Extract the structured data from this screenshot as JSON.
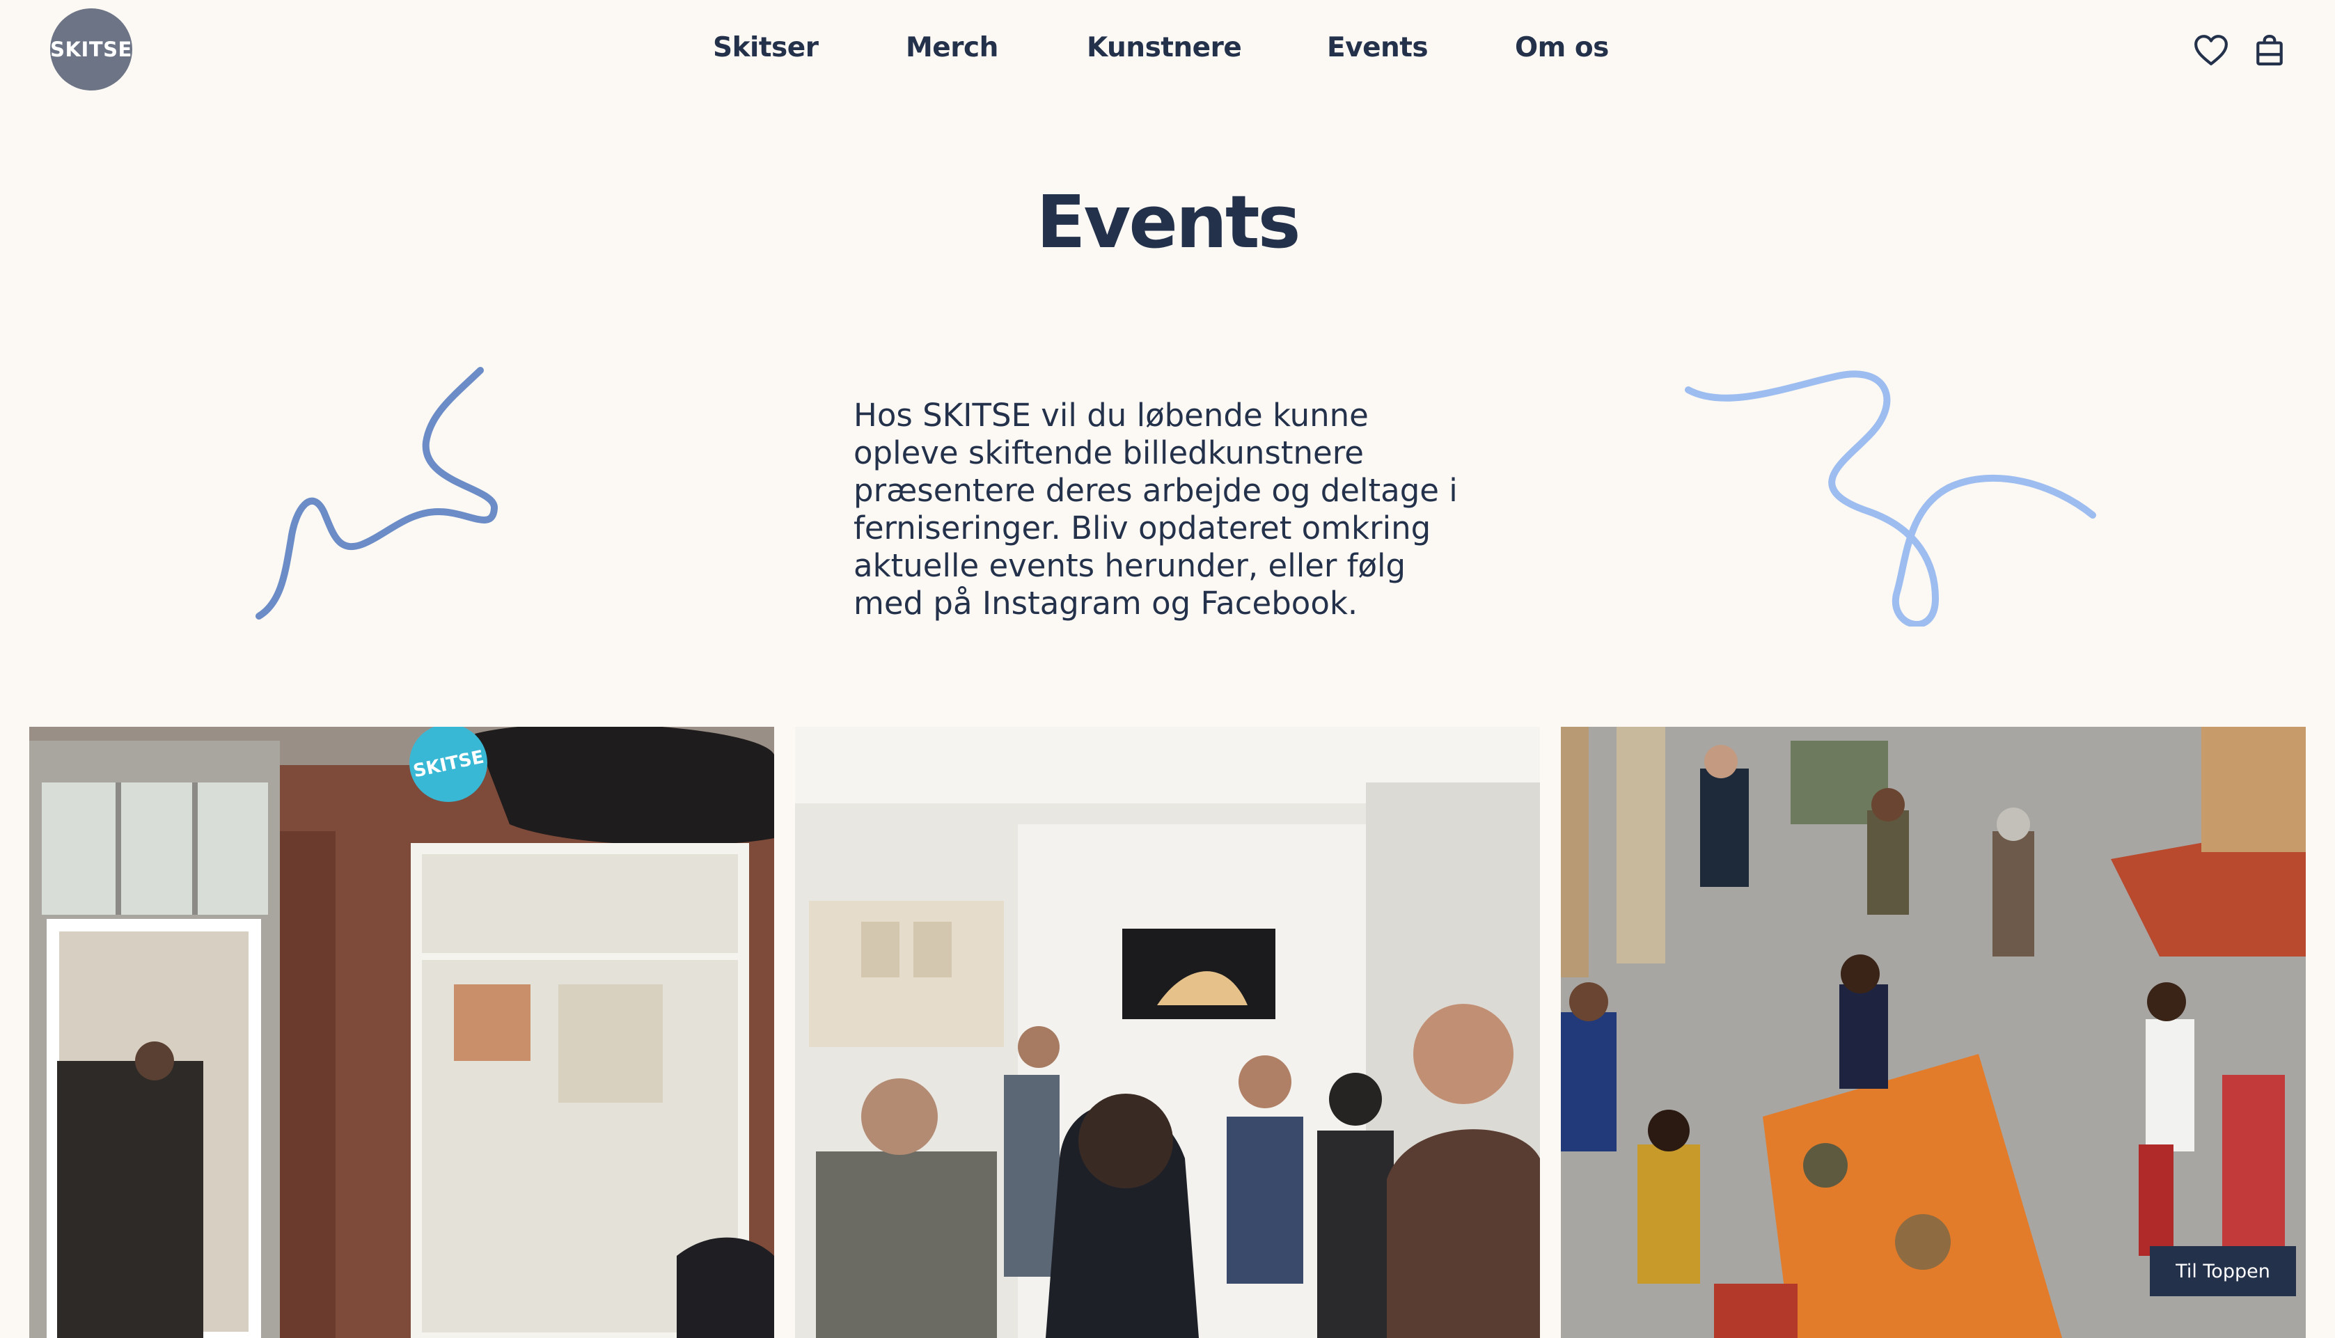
{
  "brand": {
    "logo_text": "SKITSE"
  },
  "nav": {
    "items": [
      {
        "label": "Skitser"
      },
      {
        "label": "Merch"
      },
      {
        "label": "Kunstnere"
      },
      {
        "label": "Events"
      },
      {
        "label": "Om os"
      }
    ]
  },
  "header_icons": [
    "heart-icon",
    "shopping-bag-icon"
  ],
  "page": {
    "title": "Events",
    "intro": "Hos SKITSE vil du løbende kunne opleve skiftende billedkunstnere præsentere deres arbejde og deltage i ferniseringer. Bliv opdateret omkring aktuelle events herunder, eller følg med på Instagram og Facebook."
  },
  "gallery": {
    "photos": [
      {
        "sign_text": "SKITSE"
      },
      {},
      {}
    ]
  },
  "to_top": {
    "label": "Til Toppen"
  },
  "colors": {
    "background": "#fcf9f4",
    "text": "#24314b",
    "logo_bg": "#6c7485",
    "squiggle_left": "#6b8cc6",
    "squiggle_right": "#9dbdf0",
    "button_bg": "#24314b"
  }
}
